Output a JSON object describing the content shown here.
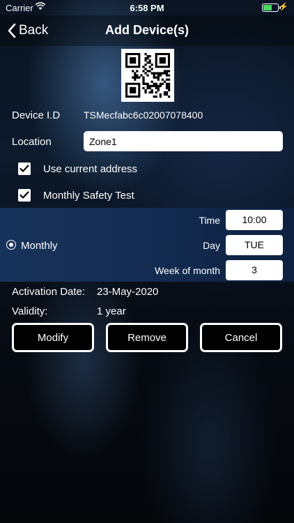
{
  "status_bar": {
    "carrier": "Carrier",
    "time": "6:58 PM",
    "battery_level_percent": 60
  },
  "nav": {
    "back_label": "Back",
    "title": "Add Device(s)"
  },
  "device": {
    "id_label": "Device I.D",
    "id_value": "TSMecfabc6c02007078400",
    "location_label": "Location",
    "location_value": "Zone1"
  },
  "options": {
    "use_current_address": {
      "label": "Use current address",
      "checked": true
    },
    "monthly_safety_test": {
      "label": "Monthly Safety Test",
      "checked": true
    }
  },
  "schedule": {
    "frequency_label": "Monthly",
    "time_label": "Time",
    "time_value": "10:00",
    "day_label": "Day",
    "day_value": "TUE",
    "week_label": "Week of month",
    "week_value": "3"
  },
  "activation": {
    "date_label": "Activation Date:",
    "date_value": "23-May-2020",
    "validity_label": "Validity:",
    "validity_value": "1 year"
  },
  "buttons": {
    "modify": "Modify",
    "remove": "Remove",
    "cancel": "Cancel"
  },
  "colors": {
    "accent_band": "#17325a",
    "battery": "#4cd964"
  }
}
